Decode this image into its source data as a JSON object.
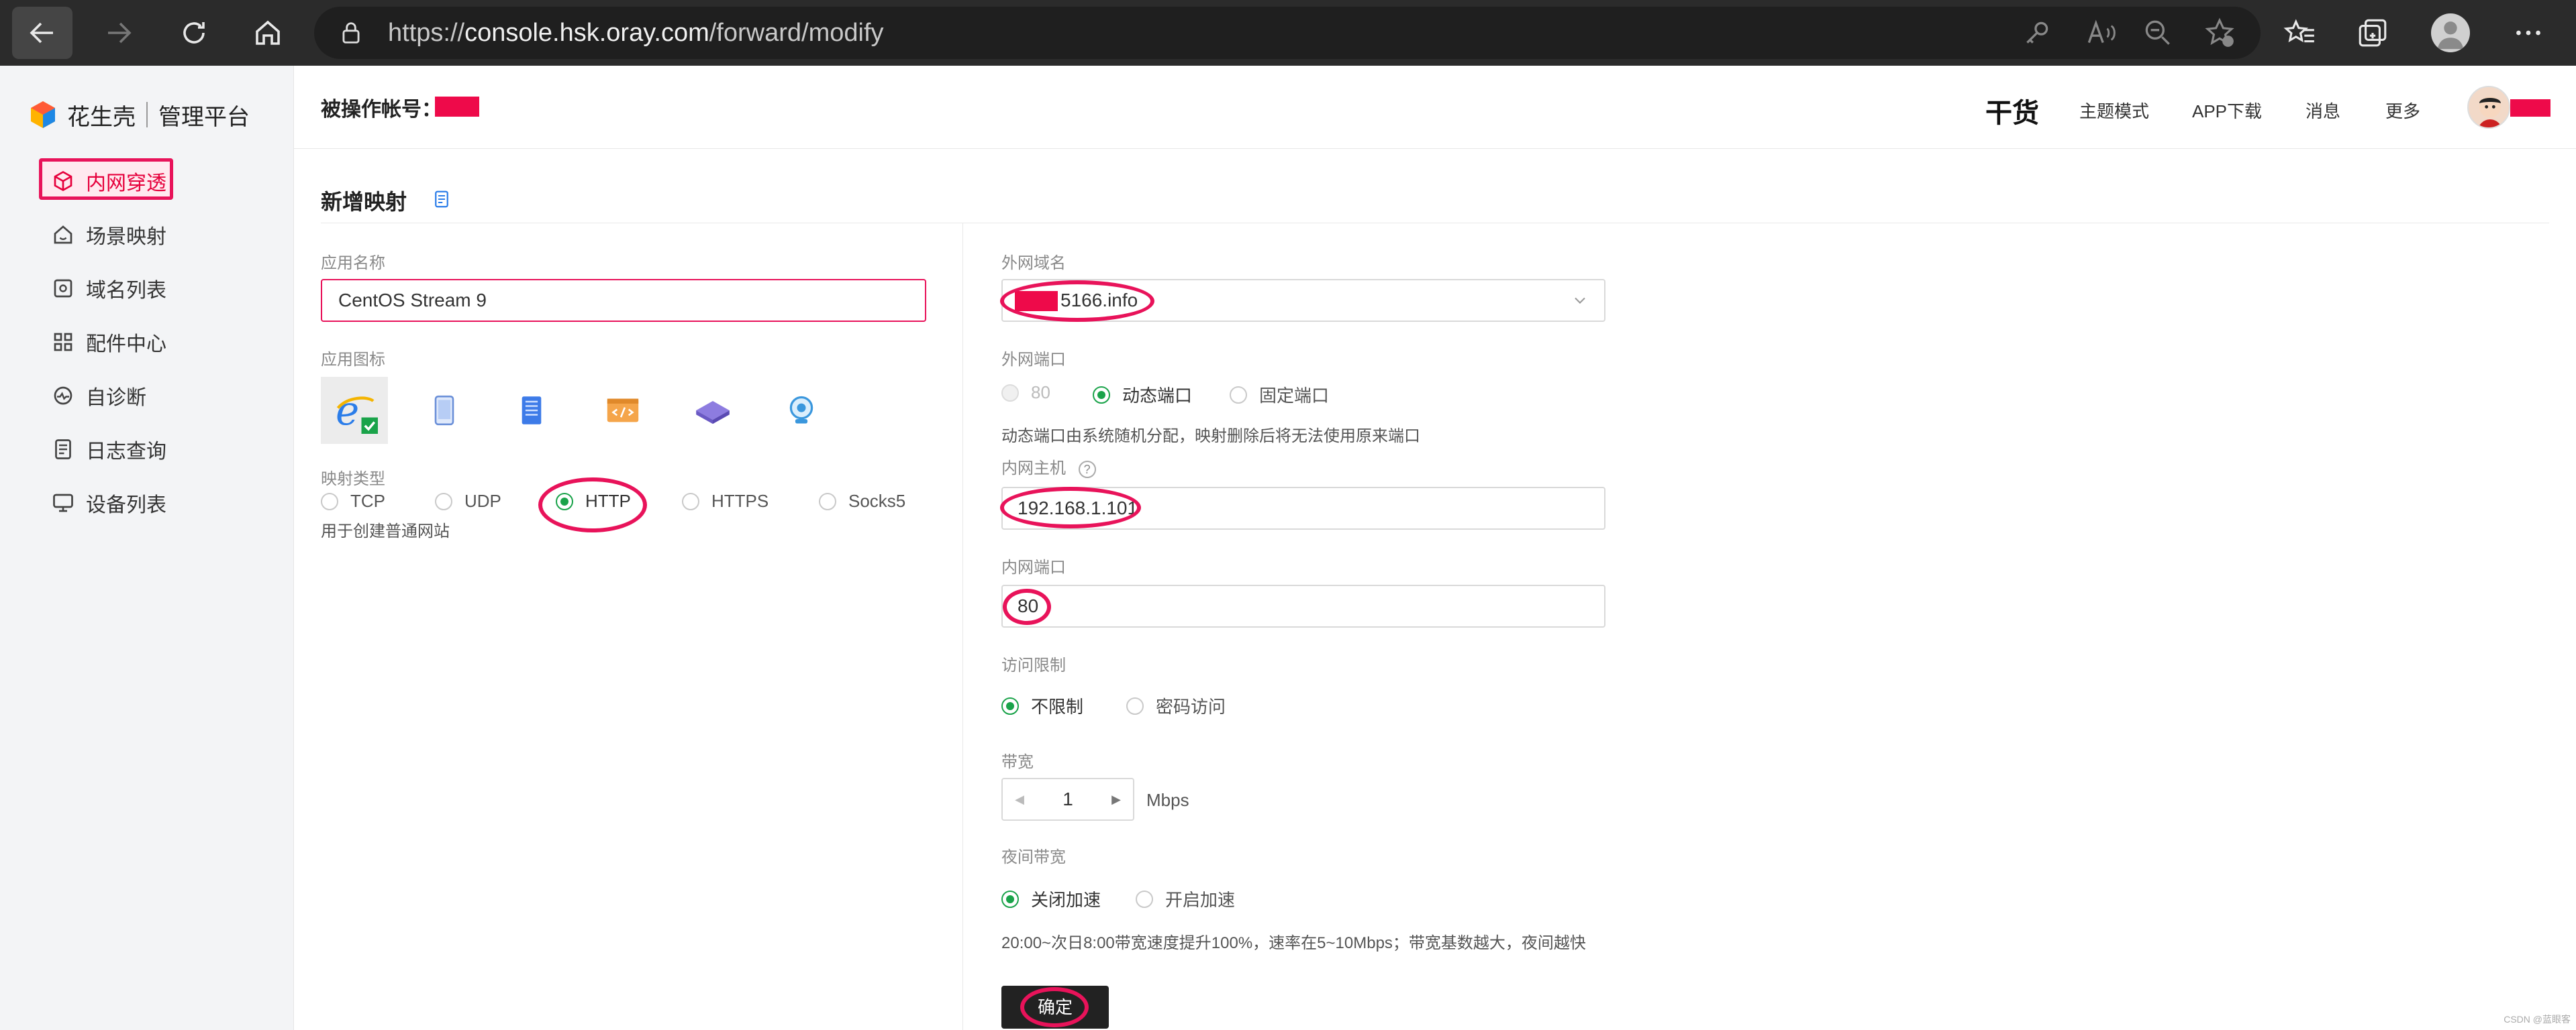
{
  "browser": {
    "url_scheme": "https://",
    "url_host": "console.hsk.oray.com",
    "url_path": "/forward/modify"
  },
  "sidebar": {
    "brand_name": "花生壳",
    "brand_sub": "管理平台",
    "items": [
      {
        "label": "内网穿透",
        "icon": "cube-icon",
        "active": true
      },
      {
        "label": "场景映射",
        "icon": "home-scene-icon"
      },
      {
        "label": "域名列表",
        "icon": "domain-list-icon"
      },
      {
        "label": "配件中心",
        "icon": "grid-icon"
      },
      {
        "label": "自诊断",
        "icon": "diagnose-icon"
      },
      {
        "label": "日志查询",
        "icon": "log-icon"
      },
      {
        "label": "设备列表",
        "icon": "monitor-icon"
      }
    ]
  },
  "header": {
    "operated_account_label": "被操作帐号：",
    "gan_logo": "干货",
    "links": [
      "主题模式",
      "APP下载",
      "消息",
      "更多"
    ]
  },
  "page": {
    "title": "新增映射"
  },
  "form_left": {
    "app_name_label": "应用名称",
    "app_name_value": "CentOS Stream 9",
    "app_icon_label": "应用图标",
    "app_icons": [
      "ie-icon",
      "tablet-icon",
      "server-icon",
      "code-icon",
      "router-icon",
      "camera-icon"
    ],
    "map_type_label": "映射类型",
    "map_types": [
      "TCP",
      "UDP",
      "HTTP",
      "HTTPS",
      "Socks5"
    ],
    "map_type_selected": "HTTP",
    "map_type_hint": "用于创建普通网站"
  },
  "form_right": {
    "domain_label": "外网域名",
    "domain_value": "5166.info",
    "ext_port_label": "外网端口",
    "ext_port_options": [
      "80",
      "动态端口",
      "固定端口"
    ],
    "ext_port_selected": "动态端口",
    "ext_port_hint": "动态端口由系统随机分配，映射删除后将无法使用原来端口",
    "host_label": "内网主机",
    "host_value": "192.168.1.101",
    "int_port_label": "内网端口",
    "int_port_value": "80",
    "access_label": "访问限制",
    "access_options": [
      "不限制",
      "密码访问"
    ],
    "access_selected": "不限制",
    "bandwidth_label": "带宽",
    "bandwidth_value": "1",
    "bandwidth_unit": "Mbps",
    "night_label": "夜间带宽",
    "night_options": [
      "关闭加速",
      "开启加速"
    ],
    "night_selected": "关闭加速",
    "night_hint": "20:00~次日8:00带宽速度提升100%，速率在5~10Mbps；带宽基数越大，夜间越快",
    "confirm_label": "确定"
  },
  "watermark": "CSDN @蓝眼客",
  "colors": {
    "accent_red": "#e8135a",
    "radio_green": "#1aa34a"
  }
}
